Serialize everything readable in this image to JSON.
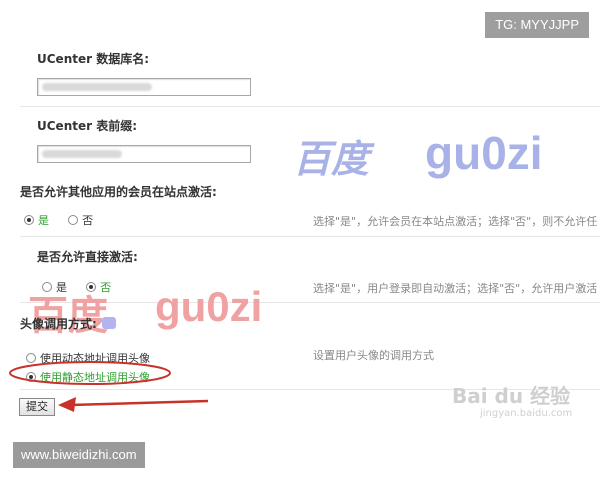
{
  "overlay_tag": "TG: MYYJJPP",
  "ucenter_db": {
    "label": "UCenter 数据库名:",
    "value": ""
  },
  "ucenter_prefix": {
    "label": "UCenter 表前缀:",
    "value": ""
  },
  "allow_other_activate": {
    "label": "是否允许其他应用的会员在站点激活:",
    "options": [
      "是",
      "否"
    ],
    "selected": "是",
    "tip": "选择\"是\"，允许会员在本站点激活；选择\"否\"，则不允许任"
  },
  "allow_direct_activate": {
    "label": "是否允许直接激活:",
    "options": [
      "是",
      "否"
    ],
    "selected": "否",
    "tip": "选择\"是\"，用户登录即自动激活；选择\"否\"，允许用户激活"
  },
  "avatar_mode": {
    "label": "头像调用方式:",
    "options": [
      "使用动态地址调用头像",
      "使用静态地址调用头像"
    ],
    "selected": "使用静态地址调用头像",
    "tip": "设置用户头像的调用方式"
  },
  "submit_label": "提交",
  "watermarks": {
    "baidu_blue": "百度",
    "guozi_blue": "gu0zi",
    "baidu_red": "百度",
    "guozi_red": "gu0zi",
    "baidu_jingyan": "Bai du 经验",
    "jingyan_url": "jingyan.baidu.com"
  },
  "site_url": "www.biweidizhi.com",
  "colors": {
    "watermark_blue": "#a8b2e6",
    "watermark_red": "#f0a2a2",
    "annotation_red": "#c8322a",
    "selected_green": "#2e9f2e"
  }
}
